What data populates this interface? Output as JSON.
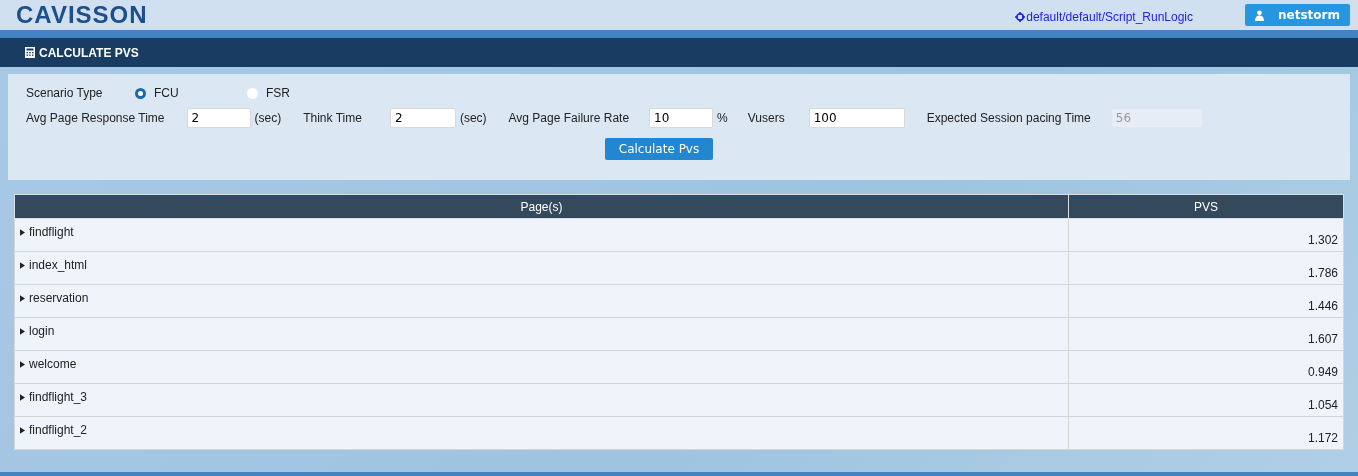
{
  "header": {
    "logo": "CAVISSON",
    "script_path": "default/default/Script_RunLogic",
    "user": "netstorm"
  },
  "title_bar": {
    "title": "CALCULATE PVS"
  },
  "form": {
    "scenario_label": "Scenario Type",
    "scenario_options": [
      {
        "label": "FCU",
        "selected": true
      },
      {
        "label": "FSR",
        "selected": false
      }
    ],
    "fields": [
      {
        "label": "Avg Page Response Time",
        "value": "2",
        "unit": "(sec)",
        "disabled": false
      },
      {
        "label": "Think Time",
        "value": "2",
        "unit": "(sec)",
        "disabled": false
      },
      {
        "label": "Avg Page Failure Rate",
        "value": "10",
        "unit": "%",
        "disabled": false
      },
      {
        "label": "Vusers",
        "value": "100",
        "disabled": false
      },
      {
        "label": "Expected Session pacing Time",
        "value": "56",
        "disabled": true
      }
    ],
    "button": "Calculate Pvs"
  },
  "table": {
    "columns": [
      "Page(s)",
      "PVS"
    ],
    "rows": [
      {
        "page": "findflight",
        "pvs": "1.302",
        "expanded": false
      },
      {
        "page": "index_html",
        "pvs": "1.786",
        "expanded": false
      },
      {
        "page": "reservation",
        "pvs": "1.446",
        "expanded": false
      },
      {
        "page": "login",
        "pvs": "1.607",
        "expanded": false
      },
      {
        "page": "welcome",
        "pvs": "0.949",
        "expanded": false
      },
      {
        "page": "findflight_3",
        "pvs": "1.054",
        "expanded": false
      },
      {
        "page": "findflight_2",
        "pvs": "1.172",
        "expanded": false
      }
    ]
  }
}
